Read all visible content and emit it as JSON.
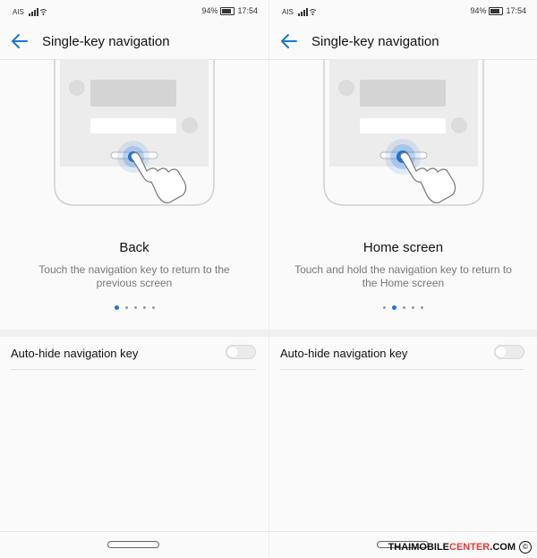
{
  "status_bar": {
    "carrier": "AIS",
    "battery": "94%",
    "time": "17:54"
  },
  "app": {
    "title": "Single-key navigation"
  },
  "pages": [
    {
      "caption": "Back",
      "description": "Touch the navigation key to return to the previous screen",
      "active_dot": 0
    },
    {
      "caption": "Home screen",
      "description": "Touch and hold the navigation key to return to the Home screen",
      "active_dot": 1
    }
  ],
  "setting": {
    "label": "Auto-hide navigation key",
    "enabled": false
  },
  "watermark": {
    "prefix": "THAIMOBILE",
    "highlight": "CENTER",
    "suffix": ".COM",
    "symbol": "©"
  },
  "colors": {
    "accent": "#1976d2",
    "touch": "#4a90e2"
  },
  "icons": {
    "back": "arrow-left-icon",
    "wifi": "wifi-icon",
    "signal": "signal-icon",
    "battery": "battery-icon",
    "hand": "pointing-hand-icon"
  }
}
